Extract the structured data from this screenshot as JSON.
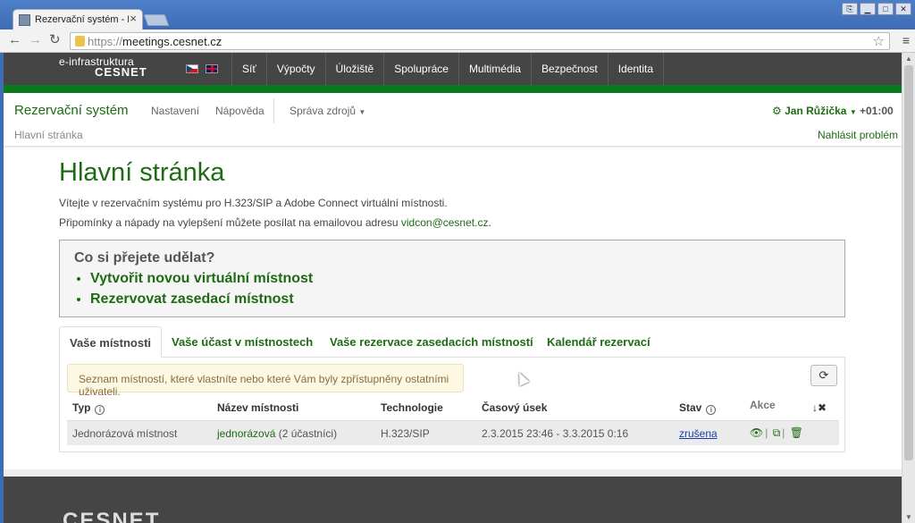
{
  "browser": {
    "tab_title": "Rezervační systém - Hlav",
    "tab_close": "×",
    "url_protocol": "https://",
    "url_host": "meetings.cesnet.cz",
    "window_buttons": [
      "⎘",
      "▁",
      "□",
      "✕"
    ]
  },
  "site_nav": {
    "logo_line1": "e-infrastruktura",
    "logo_line2": "CESNET",
    "items": [
      "Síť",
      "Výpočty",
      "Úložiště",
      "Spolupráce",
      "Multimédia",
      "Bezpečnost",
      "Identita"
    ]
  },
  "header": {
    "brand": "Rezervační systém",
    "nav_settings": "Nastavení",
    "nav_help": "Nápověda",
    "nav_resources": "Správa zdrojů",
    "user": "Jan Růžička",
    "timezone": "+01:00",
    "breadcrumb": "Hlavní stránka",
    "report_problem": "Nahlásit problém"
  },
  "main": {
    "title": "Hlavní stránka",
    "intro1": "Vítejte v rezervačním systému pro H.323/SIP a Adobe Connect virtuální místnosti.",
    "intro2_prefix": "Připomínky a nápady na vylepšení můžete posílat na emailovou adresu ",
    "intro2_email": "vidcon@cesnet.cz",
    "intro2_suffix": ".",
    "what_title": "Co si přejete udělat?",
    "actions": [
      "Vytvořit novou virtuální místnost",
      "Rezervovat zasedací místnost"
    ]
  },
  "tabs": [
    "Vaše místnosti",
    "Vaše účast v místnostech",
    "Vaše rezervace zasedacích místností",
    "Kalendář rezervací"
  ],
  "panel": {
    "alert": "Seznam místností, které vlastníte nebo které Vám byly zpřístupněny ostatními uživateli.",
    "columns": {
      "type": "Typ",
      "name": "Název místnosti",
      "technology": "Technologie",
      "slot": "Časový úsek",
      "state": "Stav",
      "actions": "Akce"
    },
    "rows": [
      {
        "type": "Jednorázová místnost",
        "name": "jednorázová",
        "participants": " (2 účastníci)",
        "technology": "H.323/SIP",
        "slot": "2.3.2015 23:46 - 3.3.2015 0:16",
        "state": "zrušena"
      }
    ]
  }
}
